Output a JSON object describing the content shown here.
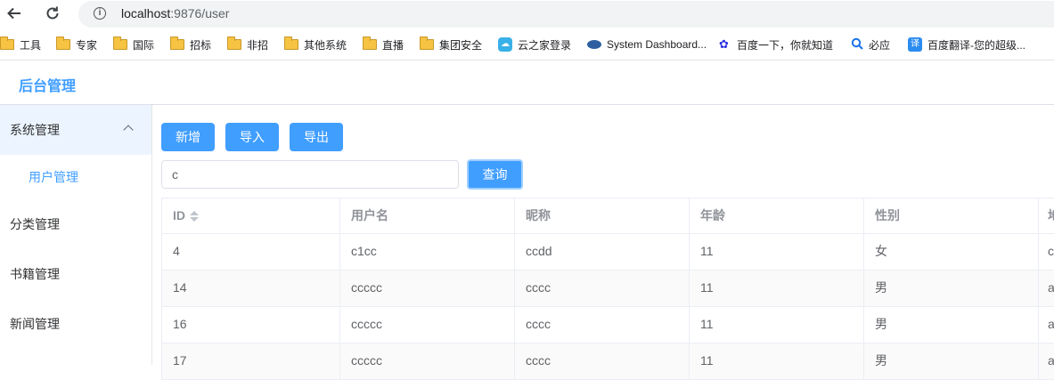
{
  "browser": {
    "url_host": "localhost",
    "url_rest": ":9876/user",
    "bookmarks": [
      {
        "label": "工具",
        "icon": "folder-icon"
      },
      {
        "label": "专家",
        "icon": "folder-icon"
      },
      {
        "label": "国际",
        "icon": "folder-icon"
      },
      {
        "label": "招标",
        "icon": "folder-icon"
      },
      {
        "label": "非招",
        "icon": "folder-icon"
      },
      {
        "label": "其他系统",
        "icon": "folder-icon"
      },
      {
        "label": "直播",
        "icon": "folder-icon"
      },
      {
        "label": "集团安全",
        "icon": "folder-icon"
      },
      {
        "label": "云之家登录",
        "icon": "cloud-icon"
      },
      {
        "label": "System Dashboard...",
        "icon": "dashboard-icon"
      },
      {
        "label": "百度一下，你就知道",
        "icon": "baidu-paw-icon"
      },
      {
        "label": "必应",
        "icon": "search-icon"
      },
      {
        "label": "百度翻译-您的超级...",
        "icon": "translate-icon"
      }
    ]
  },
  "app": {
    "title": "后台管理"
  },
  "sidebar": {
    "groups": [
      {
        "label": "系统管理",
        "expanded": true,
        "children": [
          {
            "label": "用户管理",
            "active": true
          }
        ]
      },
      {
        "label": "分类管理"
      },
      {
        "label": "书籍管理"
      },
      {
        "label": "新闻管理"
      }
    ]
  },
  "toolbar": {
    "add_label": "新增",
    "import_label": "导入",
    "export_label": "导出"
  },
  "search": {
    "value": "c",
    "query_label": "查询"
  },
  "table": {
    "columns": [
      "ID",
      "用户名",
      "昵称",
      "年龄",
      "性别",
      "地"
    ],
    "rows": [
      [
        "4",
        "c1cc",
        "ccdd",
        "11",
        "女",
        "c"
      ],
      [
        "14",
        "ccccc",
        "cccc",
        "11",
        "男",
        "a"
      ],
      [
        "16",
        "ccccc",
        "cccc",
        "11",
        "男",
        "a"
      ],
      [
        "17",
        "ccccc",
        "cccc",
        "11",
        "男",
        "a"
      ]
    ]
  },
  "colors": {
    "primary": "#409eff",
    "menu_open_bg": "#ecf5ff"
  }
}
